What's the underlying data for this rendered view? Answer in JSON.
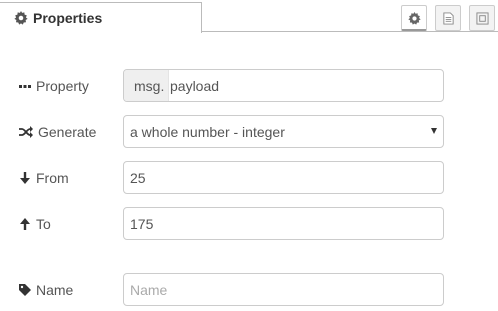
{
  "tab": {
    "title": "Properties",
    "icon": "gear-icon"
  },
  "toolbar": {
    "buttons": [
      {
        "icon": "gear-icon",
        "selected": true
      },
      {
        "icon": "document-icon",
        "selected": false
      },
      {
        "icon": "layout-icon",
        "selected": false
      }
    ]
  },
  "form": {
    "property": {
      "label": "Property",
      "prefix": "msg.",
      "value": "payload",
      "icon": "ellipsis-icon"
    },
    "generate": {
      "label": "Generate",
      "value": "a whole number - integer",
      "icon": "shuffle-icon"
    },
    "from": {
      "label": "From",
      "value": "25",
      "icon": "arrow-down-icon"
    },
    "to": {
      "label": "To",
      "value": "175",
      "icon": "arrow-up-icon"
    },
    "name": {
      "label": "Name",
      "value": "",
      "placeholder": "Name",
      "icon": "tag-icon"
    }
  },
  "colors": {
    "text": "#555555",
    "border": "#cccccc",
    "prefix_bg": "#efefef"
  }
}
